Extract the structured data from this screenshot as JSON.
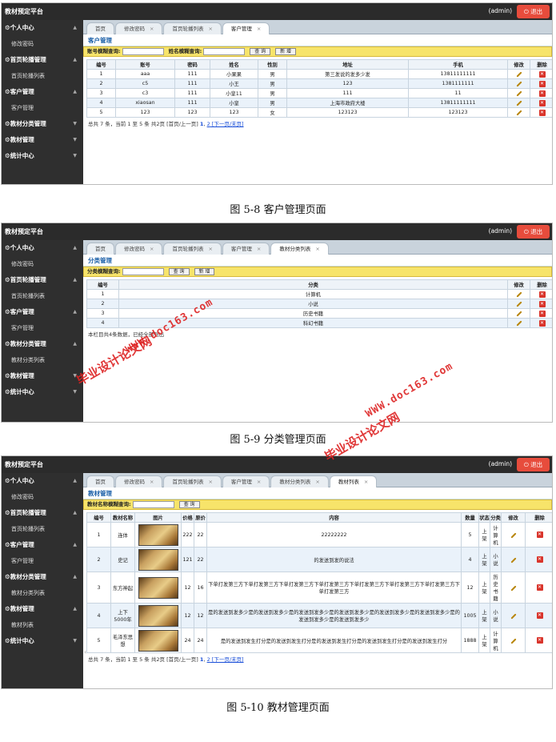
{
  "app": {
    "brand": "教材预定平台",
    "admin": "(admin)",
    "logout": "⏻ 退出"
  },
  "sidebar": {
    "personal": "⚙个人中心",
    "change_pwd": "修改密码",
    "carousel": "⚙首页轮播管理",
    "carousel_list": "首页轮播列表",
    "customer": "⚙客户管理",
    "customer_mgmt": "客户管理",
    "category": "⚙教材分类管理",
    "category_list": "教材分类列表",
    "textbook": "⚙教材管理",
    "textbook_list": "教材列表",
    "stats": "⚙统计中心"
  },
  "tabs": {
    "home": "首页",
    "pwd": "修改密码",
    "carousel": "首页轮播列表",
    "customer": "客户管理",
    "category": "教材分类列表",
    "textbook": "教材列表",
    "close": "×"
  },
  "shot1": {
    "title": "客户管理",
    "q1": "账号模糊查询:",
    "q2": "姓名模糊查询:",
    "query": "查 询",
    "add": "新 增",
    "headers": [
      "编号",
      "账号",
      "密码",
      "姓名",
      "性别",
      "地址",
      "手机",
      "修改",
      "删除"
    ],
    "rows": [
      [
        "1",
        "aaa",
        "111",
        "小果果",
        "男",
        "第三发说的发多少发",
        "13811111111"
      ],
      [
        "2",
        "c5",
        "111",
        "小王",
        "男",
        "123",
        "1381111111"
      ],
      [
        "3",
        "c3",
        "111",
        "小皇11",
        "男",
        "111",
        "11"
      ],
      [
        "4",
        "xiaosan",
        "111",
        "小皇",
        "男",
        "上海市政府大楼",
        "13811111111"
      ],
      [
        "5",
        "123",
        "123",
        "123",
        "女",
        "123123",
        "123123"
      ]
    ],
    "pager": {
      "info": "总共 7 条，当前 1 至 5 条 共2页 [首页/上一页] ",
      "p1": "1",
      "sep": ", ",
      "p2": "2",
      "links": " [下一页/末页]"
    }
  },
  "shot2": {
    "title": "分类管理",
    "q1": "分类模糊查询:",
    "query": "查 询",
    "add": "新 增",
    "headers": [
      "编号",
      "分类",
      "修改",
      "删除"
    ],
    "rows": [
      [
        "1",
        "计算机"
      ],
      [
        "2",
        "小说"
      ],
      [
        "3",
        "历史书籍"
      ],
      [
        "4",
        "科幻书籍"
      ]
    ],
    "note": "本栏目共4条数据，已经全部列出"
  },
  "shot3": {
    "title": "教材管理",
    "q1": "教材名称模糊查询:",
    "query": "查 询",
    "headers": [
      "编号",
      "教材名称",
      "图片",
      "价格",
      "原价",
      "内容",
      "数量",
      "状态",
      "分类",
      "修改",
      "删除"
    ],
    "rows": [
      [
        "1",
        "连体",
        "222",
        "22",
        "22222222",
        "5",
        "上架",
        "计算机"
      ],
      [
        "2",
        "史记",
        "121",
        "22",
        "的发送到发的说法",
        "4",
        "上架",
        "小说"
      ],
      [
        "3",
        "东方神起",
        "12",
        "16",
        "下单打发第三方下单打发第三方下单打发第三方下单打发第三方下单打发第三方下单打发第三方下单打发第三方下单打发第三方",
        "12",
        "上架",
        "历史书籍"
      ],
      [
        "4",
        "上下5000年",
        "12",
        "12",
        "是的发送到发多少是的发送到发多少是的发送到发多少是的发送到发多少是的发送到发多少是的发送到发多少是的发送到发多少是的发送到发多少",
        "1005",
        "上架",
        "小说"
      ],
      [
        "5",
        "毛泽东思想",
        "24",
        "24",
        "是的发送到发生打分是的发送到发生打分是的发送到发生打分是的发送到发生打分是的发送到发生打分",
        "1888",
        "上架",
        "计算机"
      ]
    ],
    "pager": {
      "info": "总共 7 条，当前 1 至 5 条 共2页 [首页/上一页] ",
      "p1": "1",
      "sep": ", ",
      "p2": "2",
      "links": " [下一页/末页]"
    }
  },
  "captions": {
    "c1": "图 5-8 客户管理页面",
    "c2": "图 5-9 分类管理页面",
    "c3": "图 5-10 教材管理页面"
  },
  "watermarks": {
    "cn": "毕业设计论文网",
    "url": "WWW.doc163.com"
  },
  "icons": {
    "edit": "pencil-icon",
    "delete": "delete-x-icon",
    "scroll": "chevron-left-icon"
  },
  "colors": {
    "topbar": "#2b2b2b",
    "sidebar": "#2f2f2f",
    "logout": "#e74c3c",
    "search_bar": "#f7e46a",
    "title": "#1a5fa8",
    "watermark": "#dd2222"
  }
}
